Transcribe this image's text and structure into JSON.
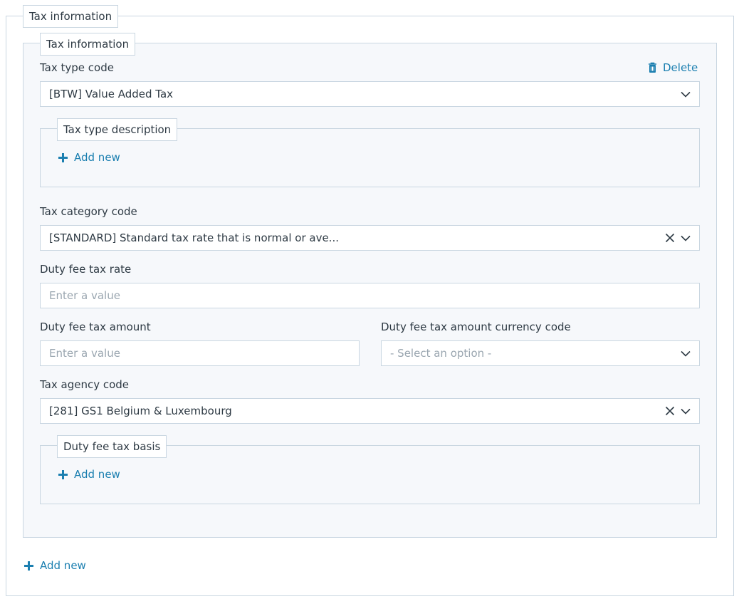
{
  "outer": {
    "legend": "Tax information",
    "add_new": "Add new"
  },
  "inner": {
    "legend": "Tax information",
    "delete": "Delete",
    "tax_type_code": {
      "label": "Tax type code",
      "value": "[BTW] Value Added Tax"
    },
    "tax_type_description": {
      "legend": "Tax type description",
      "add_new": "Add new"
    },
    "tax_category_code": {
      "label": "Tax category code",
      "value": "[STANDARD] Standard tax rate that is normal or ave..."
    },
    "duty_fee_tax_rate": {
      "label": "Duty fee tax rate",
      "placeholder": "Enter a value"
    },
    "duty_fee_tax_amount": {
      "label": "Duty fee tax amount",
      "placeholder": "Enter a value"
    },
    "duty_fee_tax_amount_currency_code": {
      "label": "Duty fee tax amount currency code",
      "placeholder": "- Select an option -"
    },
    "tax_agency_code": {
      "label": "Tax agency code",
      "value": "[281] GS1 Belgium & Luxembourg"
    },
    "duty_fee_tax_basis": {
      "legend": "Duty fee tax basis",
      "add_new": "Add new"
    }
  },
  "colors": {
    "accent": "#1b7fb0",
    "border": "#c9d6e1",
    "panel": "#f6f8fb",
    "text": "#2e3a44",
    "placeholder": "#9aa6b0"
  },
  "icons": [
    "trash-icon",
    "chevron-down-icon",
    "clear-icon",
    "plus-icon"
  ]
}
